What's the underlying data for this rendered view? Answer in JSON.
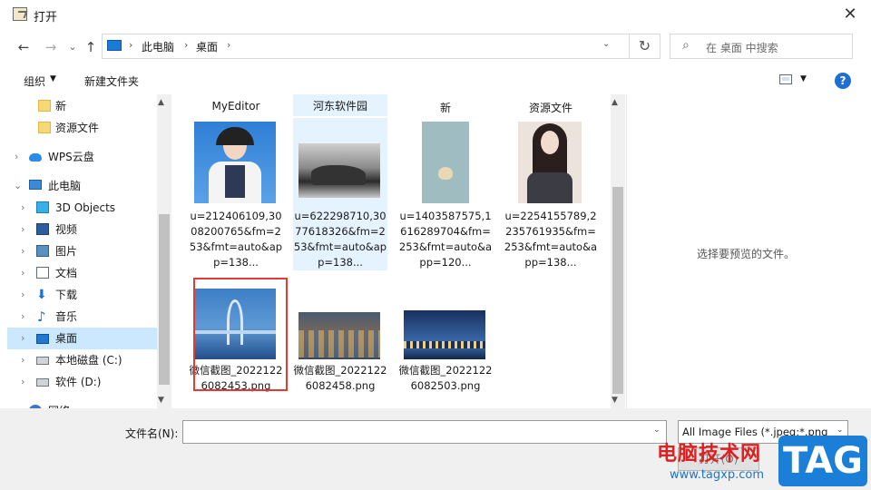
{
  "window": {
    "title": "打开",
    "close": "✕"
  },
  "nav_buttons": {
    "back": "←",
    "forward": "→",
    "recent": "⌄",
    "up": "↑"
  },
  "address": {
    "crumbs": [
      "此电脑",
      "桌面"
    ],
    "sep": "›",
    "dropdown": "⌄",
    "refresh": "↻"
  },
  "search": {
    "placeholder": "在 桌面 中搜索",
    "icon": "⌕"
  },
  "toolbar": {
    "organize": "组织",
    "organize_dd": "▼",
    "new_folder": "新建文件夹",
    "view_dd": "▼",
    "help": "?"
  },
  "sidebar": {
    "items": [
      {
        "label": "新",
        "chev": ""
      },
      {
        "label": "资源文件",
        "chev": ""
      },
      {
        "label": "WPS云盘",
        "chev": "›"
      },
      {
        "label": "此电脑",
        "chev": "⌄"
      },
      {
        "label": "3D Objects",
        "chev": "›"
      },
      {
        "label": "视频",
        "chev": "›"
      },
      {
        "label": "图片",
        "chev": "›"
      },
      {
        "label": "文档",
        "chev": "›"
      },
      {
        "label": "下载",
        "chev": "›"
      },
      {
        "label": "音乐",
        "chev": "›"
      },
      {
        "label": "桌面",
        "chev": "›"
      },
      {
        "label": "本地磁盘 (C:)",
        "chev": "›"
      },
      {
        "label": "软件 (D:)",
        "chev": "›"
      },
      {
        "label": "网络",
        "chev": "›"
      }
    ]
  },
  "files": {
    "folders": [
      "MyEditor",
      "河东软件园",
      "新",
      "资源文件"
    ],
    "row1": [
      {
        "caption": "u=212406109,3008200765&fm=253&fmt=auto&app=138..."
      },
      {
        "caption": "u=622298710,3077618326&fm=253&fmt=auto&app=138..."
      },
      {
        "caption": "u=1403587575,1616289704&fm=253&fmt=auto&app=120..."
      },
      {
        "caption": "u=2254155789,2235761935&fm=253&fmt=auto&app=138..."
      }
    ],
    "row2": [
      {
        "caption": "微信截图_20221226082453.png"
      },
      {
        "caption": "微信截图_20221226082458.png"
      },
      {
        "caption": "微信截图_20221226082503.png"
      }
    ]
  },
  "scroll": {
    "up": "▲",
    "down": "▼"
  },
  "preview": {
    "empty_text": "选择要预览的文件。"
  },
  "bottom": {
    "filename_label": "文件名(N):",
    "filename_value": "",
    "dd": "⌄",
    "type_value": "All Image Files (*.jpeg;*.png;",
    "open_label": "打开(O)"
  },
  "watermark": {
    "text": "电脑技术网",
    "url": "www.tagxp.com",
    "tag": "TAG"
  }
}
